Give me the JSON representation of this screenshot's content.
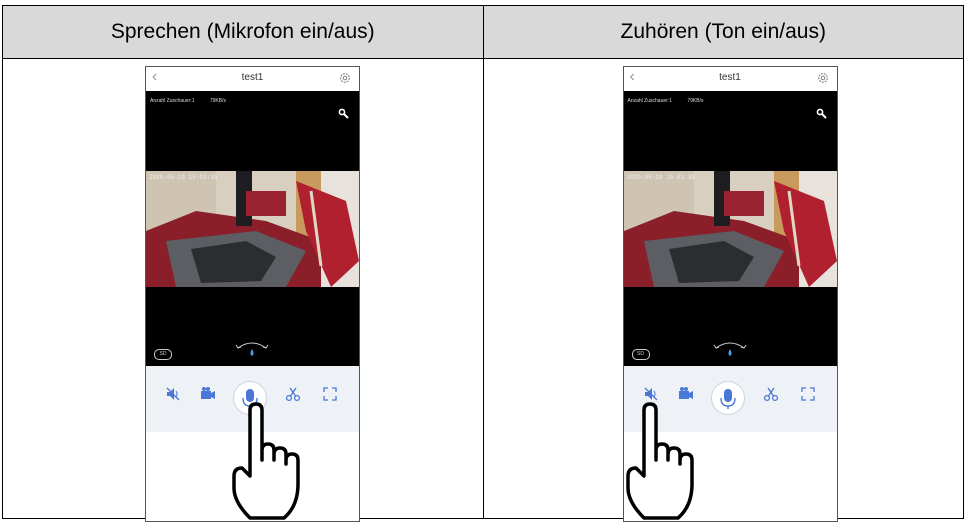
{
  "headers": {
    "left": "Sprechen (Mikrofon ein/aus)",
    "right": "Zuhören (Ton ein/aus)"
  },
  "phone": {
    "title": "test1",
    "viewers_label": "Anzahl Zuschauer:1",
    "bitrate": "79KB/s",
    "timestamp": "2020-05-19  15:03:39",
    "sd_label": "SD"
  },
  "controls": [
    "mute-speaker-icon",
    "record-video-icon",
    "microphone-icon",
    "scissors-icon",
    "fullscreen-icon"
  ],
  "colors": {
    "accent": "#4a78d6",
    "header_bg": "#d9d9d9",
    "controls_bg": "#eef1f5"
  }
}
